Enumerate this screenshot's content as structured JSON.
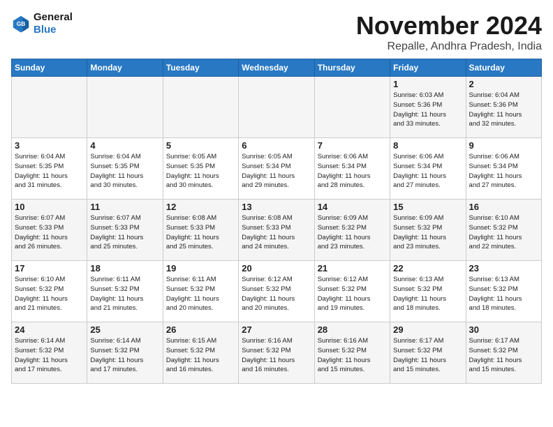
{
  "logo": {
    "line1": "General",
    "line2": "Blue"
  },
  "title": "November 2024",
  "location": "Repalle, Andhra Pradesh, India",
  "weekdays": [
    "Sunday",
    "Monday",
    "Tuesday",
    "Wednesday",
    "Thursday",
    "Friday",
    "Saturday"
  ],
  "weeks": [
    [
      {
        "day": "",
        "info": ""
      },
      {
        "day": "",
        "info": ""
      },
      {
        "day": "",
        "info": ""
      },
      {
        "day": "",
        "info": ""
      },
      {
        "day": "",
        "info": ""
      },
      {
        "day": "1",
        "info": "Sunrise: 6:03 AM\nSunset: 5:36 PM\nDaylight: 11 hours\nand 33 minutes."
      },
      {
        "day": "2",
        "info": "Sunrise: 6:04 AM\nSunset: 5:36 PM\nDaylight: 11 hours\nand 32 minutes."
      }
    ],
    [
      {
        "day": "3",
        "info": "Sunrise: 6:04 AM\nSunset: 5:35 PM\nDaylight: 11 hours\nand 31 minutes."
      },
      {
        "day": "4",
        "info": "Sunrise: 6:04 AM\nSunset: 5:35 PM\nDaylight: 11 hours\nand 30 minutes."
      },
      {
        "day": "5",
        "info": "Sunrise: 6:05 AM\nSunset: 5:35 PM\nDaylight: 11 hours\nand 30 minutes."
      },
      {
        "day": "6",
        "info": "Sunrise: 6:05 AM\nSunset: 5:34 PM\nDaylight: 11 hours\nand 29 minutes."
      },
      {
        "day": "7",
        "info": "Sunrise: 6:06 AM\nSunset: 5:34 PM\nDaylight: 11 hours\nand 28 minutes."
      },
      {
        "day": "8",
        "info": "Sunrise: 6:06 AM\nSunset: 5:34 PM\nDaylight: 11 hours\nand 27 minutes."
      },
      {
        "day": "9",
        "info": "Sunrise: 6:06 AM\nSunset: 5:34 PM\nDaylight: 11 hours\nand 27 minutes."
      }
    ],
    [
      {
        "day": "10",
        "info": "Sunrise: 6:07 AM\nSunset: 5:33 PM\nDaylight: 11 hours\nand 26 minutes."
      },
      {
        "day": "11",
        "info": "Sunrise: 6:07 AM\nSunset: 5:33 PM\nDaylight: 11 hours\nand 25 minutes."
      },
      {
        "day": "12",
        "info": "Sunrise: 6:08 AM\nSunset: 5:33 PM\nDaylight: 11 hours\nand 25 minutes."
      },
      {
        "day": "13",
        "info": "Sunrise: 6:08 AM\nSunset: 5:33 PM\nDaylight: 11 hours\nand 24 minutes."
      },
      {
        "day": "14",
        "info": "Sunrise: 6:09 AM\nSunset: 5:32 PM\nDaylight: 11 hours\nand 23 minutes."
      },
      {
        "day": "15",
        "info": "Sunrise: 6:09 AM\nSunset: 5:32 PM\nDaylight: 11 hours\nand 23 minutes."
      },
      {
        "day": "16",
        "info": "Sunrise: 6:10 AM\nSunset: 5:32 PM\nDaylight: 11 hours\nand 22 minutes."
      }
    ],
    [
      {
        "day": "17",
        "info": "Sunrise: 6:10 AM\nSunset: 5:32 PM\nDaylight: 11 hours\nand 21 minutes."
      },
      {
        "day": "18",
        "info": "Sunrise: 6:11 AM\nSunset: 5:32 PM\nDaylight: 11 hours\nand 21 minutes."
      },
      {
        "day": "19",
        "info": "Sunrise: 6:11 AM\nSunset: 5:32 PM\nDaylight: 11 hours\nand 20 minutes."
      },
      {
        "day": "20",
        "info": "Sunrise: 6:12 AM\nSunset: 5:32 PM\nDaylight: 11 hours\nand 20 minutes."
      },
      {
        "day": "21",
        "info": "Sunrise: 6:12 AM\nSunset: 5:32 PM\nDaylight: 11 hours\nand 19 minutes."
      },
      {
        "day": "22",
        "info": "Sunrise: 6:13 AM\nSunset: 5:32 PM\nDaylight: 11 hours\nand 18 minutes."
      },
      {
        "day": "23",
        "info": "Sunrise: 6:13 AM\nSunset: 5:32 PM\nDaylight: 11 hours\nand 18 minutes."
      }
    ],
    [
      {
        "day": "24",
        "info": "Sunrise: 6:14 AM\nSunset: 5:32 PM\nDaylight: 11 hours\nand 17 minutes."
      },
      {
        "day": "25",
        "info": "Sunrise: 6:14 AM\nSunset: 5:32 PM\nDaylight: 11 hours\nand 17 minutes."
      },
      {
        "day": "26",
        "info": "Sunrise: 6:15 AM\nSunset: 5:32 PM\nDaylight: 11 hours\nand 16 minutes."
      },
      {
        "day": "27",
        "info": "Sunrise: 6:16 AM\nSunset: 5:32 PM\nDaylight: 11 hours\nand 16 minutes."
      },
      {
        "day": "28",
        "info": "Sunrise: 6:16 AM\nSunset: 5:32 PM\nDaylight: 11 hours\nand 15 minutes."
      },
      {
        "day": "29",
        "info": "Sunrise: 6:17 AM\nSunset: 5:32 PM\nDaylight: 11 hours\nand 15 minutes."
      },
      {
        "day": "30",
        "info": "Sunrise: 6:17 AM\nSunset: 5:32 PM\nDaylight: 11 hours\nand 15 minutes."
      }
    ]
  ]
}
